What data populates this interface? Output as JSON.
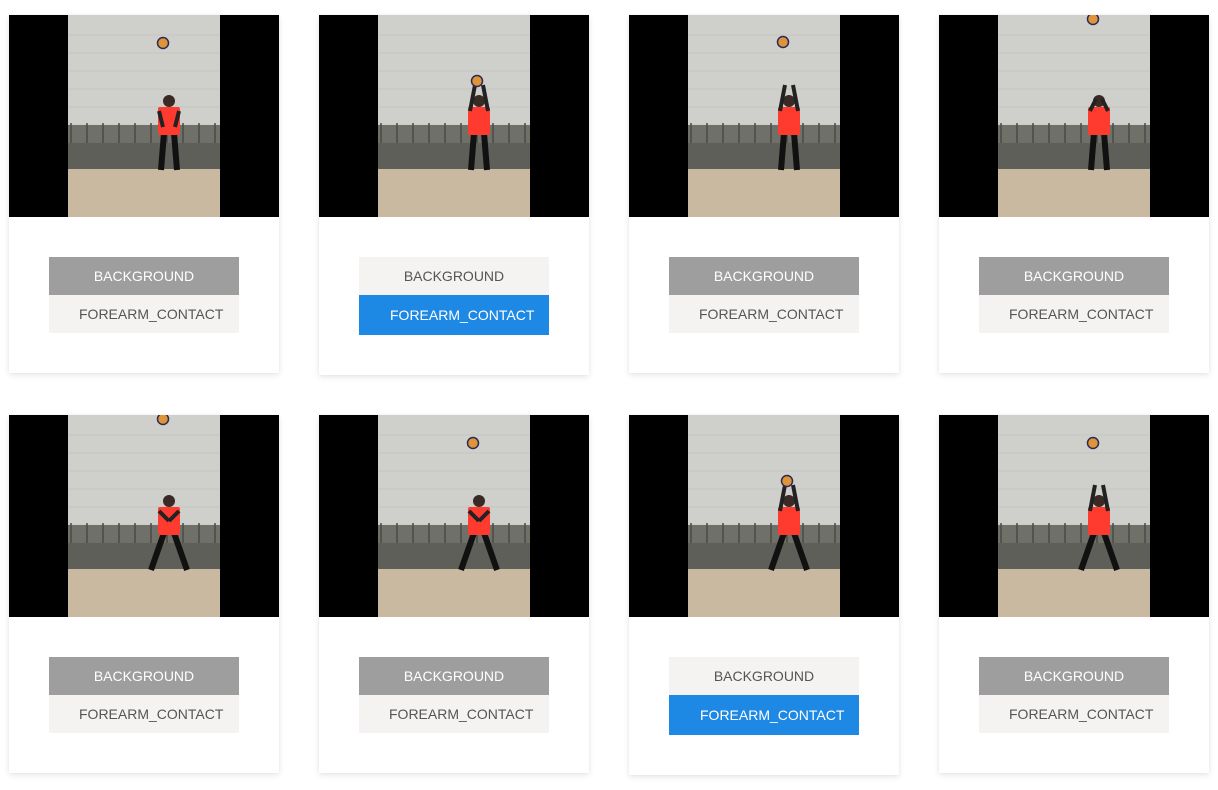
{
  "labels": {
    "background": "BACKGROUND",
    "forearm_contact": "FOREARM_CONTACT"
  },
  "colors": {
    "selected_background": "#9e9e9e",
    "selected_forearm_contact": "#1e88e5",
    "unselected": "#f4f3f1",
    "wall": "#cfcfcb",
    "ground": "#c8b9a0",
    "shirt": "#ff3b30",
    "ball": "#e0943a"
  },
  "cards": [
    {
      "selected": "BACKGROUND",
      "pose": "stand",
      "ball": "high",
      "arms": "down"
    },
    {
      "selected": "FOREARM_CONTACT",
      "pose": "stand",
      "ball": "head",
      "arms": "up"
    },
    {
      "selected": "BACKGROUND",
      "pose": "stand",
      "ball": "above",
      "arms": "up"
    },
    {
      "selected": "BACKGROUND",
      "pose": "stand",
      "ball": "top",
      "arms": "face"
    },
    {
      "selected": "BACKGROUND",
      "pose": "wide",
      "ball": "top",
      "arms": "chest"
    },
    {
      "selected": "BACKGROUND",
      "pose": "wide",
      "ball": "high",
      "arms": "chest"
    },
    {
      "selected": "FOREARM_CONTACT",
      "pose": "wide",
      "ball": "head",
      "arms": "up"
    },
    {
      "selected": "BACKGROUND",
      "pose": "wide",
      "ball": "high",
      "arms": "up"
    }
  ]
}
